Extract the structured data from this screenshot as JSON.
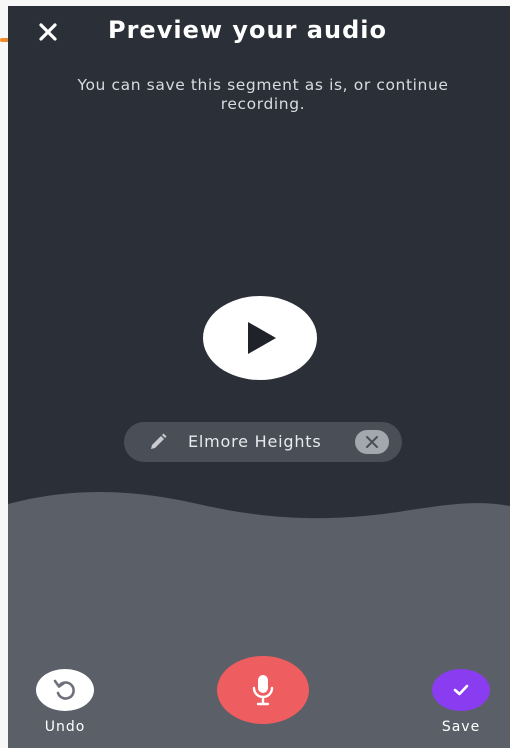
{
  "header": {
    "title": "Preview your audio",
    "close_icon": "close-icon"
  },
  "subtitle": "You can save this segment as is, or continue recording.",
  "player": {
    "play_icon": "play-icon"
  },
  "segment_chip": {
    "label": "Elmore Heights",
    "edit_icon": "pencil-icon",
    "clear_icon": "close-circle-icon"
  },
  "controls": {
    "undo_label": "Undo",
    "save_label": "Save",
    "undo_icon": "undo-icon",
    "mic_icon": "microphone-icon",
    "save_icon": "checkmark-icon"
  },
  "colors": {
    "background_dark": "#2b2f37",
    "wave_panel": "#5b5f68",
    "record_red": "#ee5d5f",
    "save_purple": "#8a3cf0",
    "accent_orange": "#f08a2c"
  }
}
